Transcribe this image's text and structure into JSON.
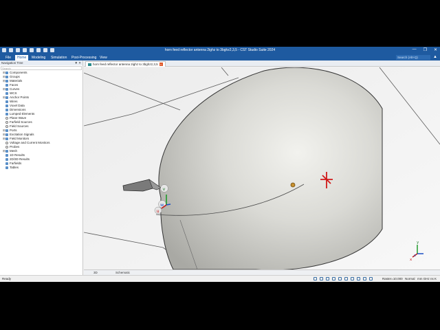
{
  "window": {
    "title": "horn feed reflector antenna 2ighz to 3bghz2,3,5 - CST Studio Suite 2024",
    "controls": [
      "minimize-icon",
      "restore-icon",
      "close-icon"
    ]
  },
  "quick_access": [
    "new-icon",
    "open-icon",
    "save-icon",
    "save-all-icon",
    "print-icon",
    "undo-icon",
    "redo-icon",
    "dropdown-icon"
  ],
  "menu": {
    "items": [
      "File",
      "Home",
      "Modeling",
      "Simulation",
      "Post-Processing",
      "View"
    ],
    "active": "Home",
    "search_placeholder": "Search (Alt+Q)"
  },
  "nav_tree": {
    "header": "Navigation Tree",
    "search_placeholder": "Search",
    "items": [
      {
        "label": "Components",
        "icon": "folder-icon",
        "expandable": true
      },
      {
        "label": "Groups",
        "icon": "folder-icon",
        "expandable": true
      },
      {
        "label": "Materials",
        "icon": "folder-icon",
        "expandable": true
      },
      {
        "label": "Faces",
        "icon": "folder-icon",
        "expandable": false
      },
      {
        "label": "Curves",
        "icon": "folder-icon",
        "expandable": true
      },
      {
        "label": "WCS",
        "icon": "folder-icon",
        "expandable": false
      },
      {
        "label": "Anchor Points",
        "icon": "folder-icon",
        "expandable": true
      },
      {
        "label": "Wires",
        "icon": "folder-icon",
        "expandable": false
      },
      {
        "label": "Voxel Data",
        "icon": "folder-icon",
        "expandable": false
      },
      {
        "label": "Dimensions",
        "icon": "folder-icon",
        "expandable": false
      },
      {
        "label": "Lumped Elements",
        "icon": "folder-icon",
        "expandable": false
      },
      {
        "label": "Plane Wave",
        "icon": "circle-icon",
        "expandable": false
      },
      {
        "label": "Farfield Sources",
        "icon": "circle-icon",
        "expandable": false
      },
      {
        "label": "Field Sources",
        "icon": "circle-icon",
        "expandable": false
      },
      {
        "label": "Ports",
        "icon": "folder-icon",
        "expandable": true
      },
      {
        "label": "Excitation Signals",
        "icon": "folder-icon",
        "expandable": true
      },
      {
        "label": "Field Monitors",
        "icon": "folder-icon",
        "expandable": true
      },
      {
        "label": "Voltage and Current Monitors",
        "icon": "circle-icon",
        "expandable": false
      },
      {
        "label": "Probes",
        "icon": "circle-icon",
        "expandable": false
      },
      {
        "label": "Mesh",
        "icon": "folder-icon",
        "expandable": true
      },
      {
        "label": "1D Results",
        "icon": "folder-icon",
        "expandable": false
      },
      {
        "label": "2D/3D Results",
        "icon": "folder-icon",
        "expandable": false
      },
      {
        "label": "Farfields",
        "icon": "folder-icon",
        "expandable": false
      },
      {
        "label": "Tables",
        "icon": "folder-icon",
        "expandable": false
      }
    ]
  },
  "document_tab": {
    "label": "horn feed reflector antenna 2ighz to 3bghz2,3,5",
    "icon": "project-icon"
  },
  "view_tabs": [
    "3D",
    "Schematic"
  ],
  "status": {
    "ready": "Ready",
    "raster": "Raster=10.000",
    "mode": "Normal",
    "units": "mm  GHz  ns  K"
  },
  "axes": {
    "x": "x",
    "y": "y",
    "z": "z"
  },
  "wcs": {
    "u": "u",
    "v": "v",
    "w": "w"
  },
  "colors": {
    "chrome": "#1e5aa0",
    "reflector": "#c9c9c4",
    "origin_marker": "#d01818"
  }
}
